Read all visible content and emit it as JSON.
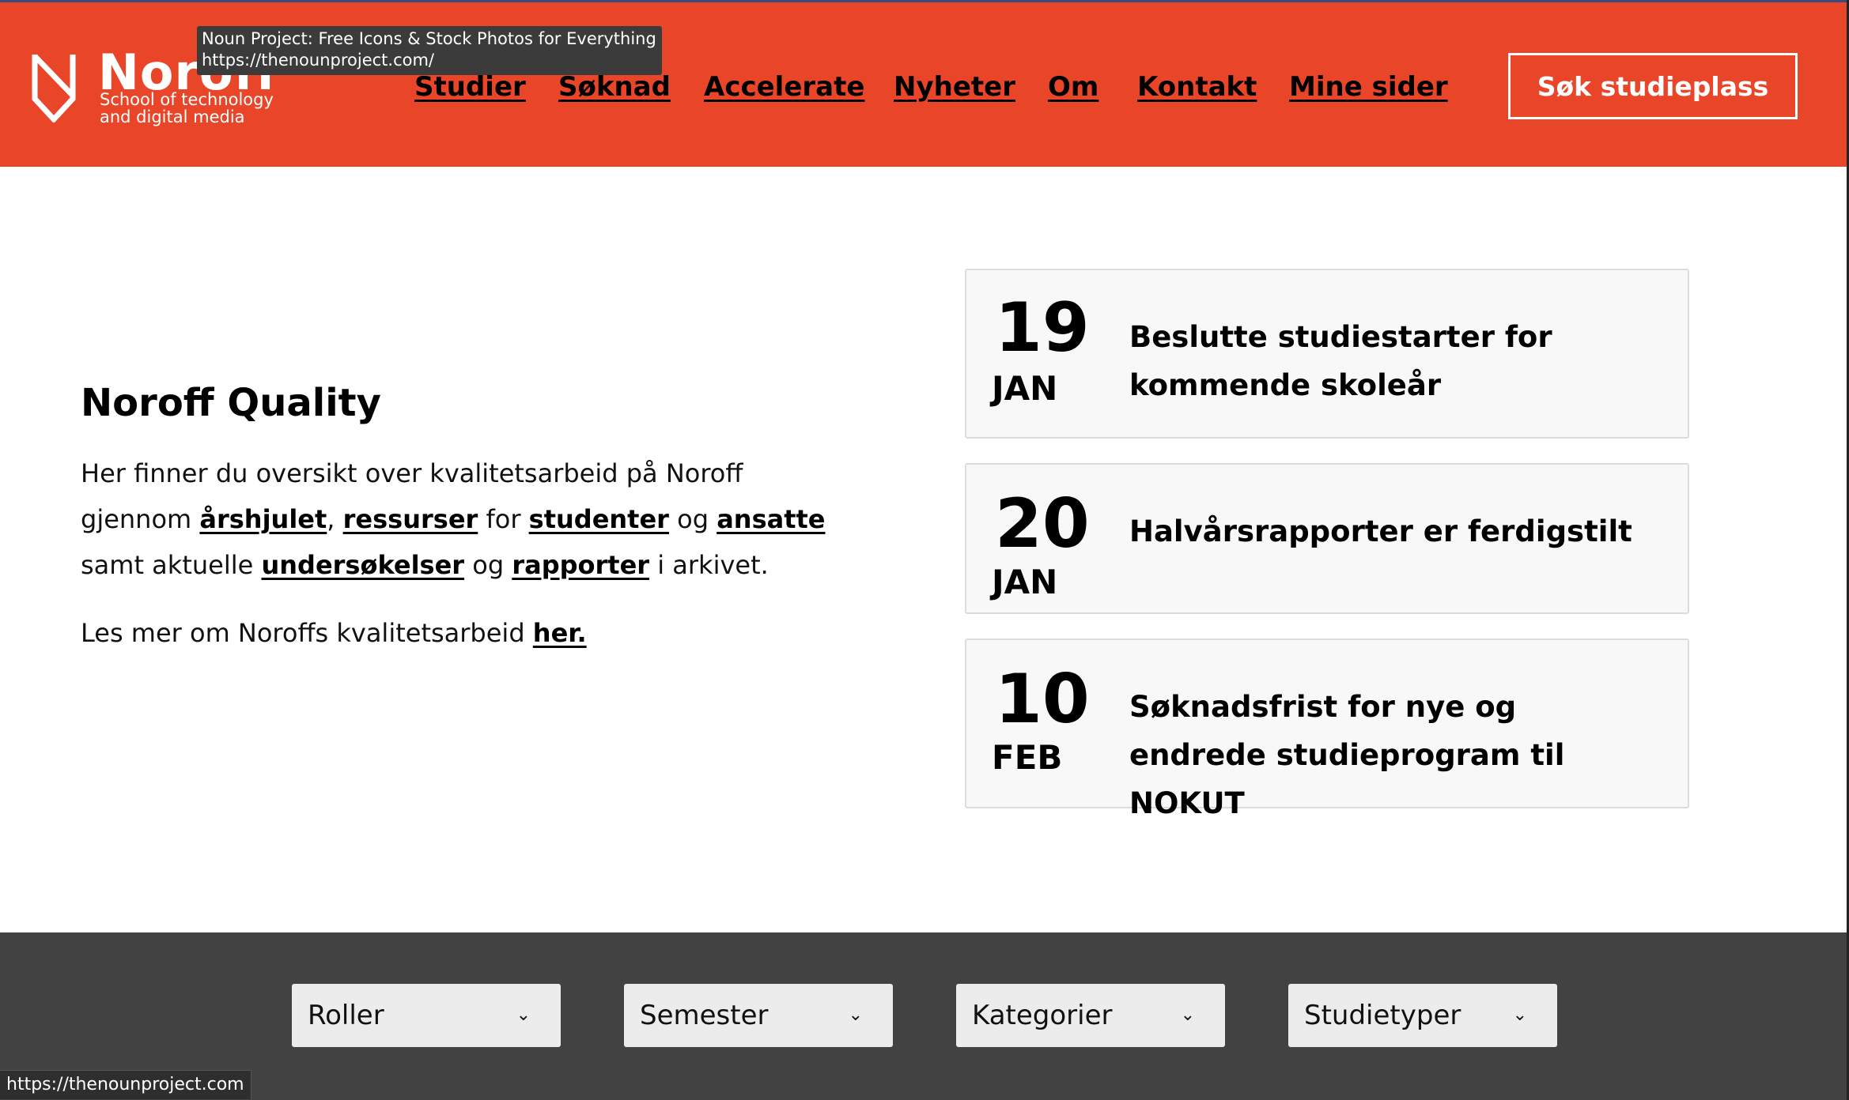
{
  "tooltip": {
    "title": "Noun Project: Free Icons & Stock Photos for Everything",
    "url": "https://thenounproject.com/"
  },
  "header": {
    "logo_word": "Noroff",
    "logo_sub": "School of technology\nand digital media",
    "nav": [
      "Studier",
      "Søknad",
      "Accelerate",
      "Nyheter",
      "Om",
      "Kontakt",
      "Mine sider"
    ],
    "cta": "Søk studieplass",
    "brand_color": "#e94629"
  },
  "intro": {
    "heading": "Noroff Quality",
    "p1": {
      "t1": "Her finner du oversikt over kvalitetsarbeid på Noroff gjennom ",
      "l1": "årshjulet",
      "t2": ", ",
      "l2": "ressurser",
      "t3": " for ",
      "l3": "studenter",
      "t4": " og ",
      "l4": "ansatte",
      "t5": " samt aktuelle ",
      "l5": "undersøkelser",
      "t6": " og ",
      "l6": "rapporter",
      "t7": " i arkivet."
    },
    "p2": {
      "t1": "Les mer om Noroffs kvalitetsarbeid ",
      "l1": "her."
    }
  },
  "events": [
    {
      "day": "19",
      "month": "JAN",
      "title": "Beslutte studiestarter for kommende skoleår"
    },
    {
      "day": "20",
      "month": "JAN",
      "title": "Halvårsrapporter er ferdigstilt"
    },
    {
      "day": "10",
      "month": "FEB",
      "title": "Søknadsfrist for nye og endrede studieprogram til NOKUT"
    }
  ],
  "filters": [
    "Roller",
    "Semester",
    "Kategorier",
    "Studietyper"
  ],
  "status_url": "https://thenounproject.com"
}
